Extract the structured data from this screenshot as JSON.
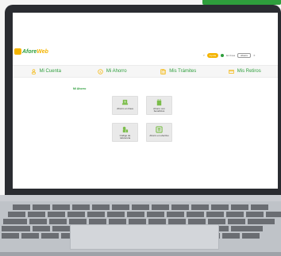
{
  "app": {
    "logo_text_1": "Afore",
    "logo_text_2": "Web",
    "brand_colors": {
      "green": "#2e9e3c",
      "yellow": "#f4b400"
    }
  },
  "header": {
    "help_badge": "Ayuda",
    "status_label": "En línea",
    "select_value": "Ahorro",
    "close_icon": "close-icon"
  },
  "nav": {
    "items": [
      {
        "label": "Mi Cuenta",
        "icon": "account-icon"
      },
      {
        "label": "Mi Ahorro",
        "icon": "savings-icon"
      },
      {
        "label": "Mis Trámites",
        "icon": "documents-icon"
      },
      {
        "label": "Mis Retiros",
        "icon": "withdrawal-icon"
      }
    ]
  },
  "main": {
    "breadcrumb": "Mi Ahorro",
    "tiles": [
      {
        "label": "Ahorro en línea",
        "icon": "online-savings-icon"
      },
      {
        "label": "Ahorro con beneficios",
        "icon": "benefits-icon"
      },
      {
        "label": "Código de referencia",
        "icon": "reference-code-icon"
      },
      {
        "label": "Ahorro en efectivo",
        "icon": "cash-savings-icon"
      }
    ]
  }
}
